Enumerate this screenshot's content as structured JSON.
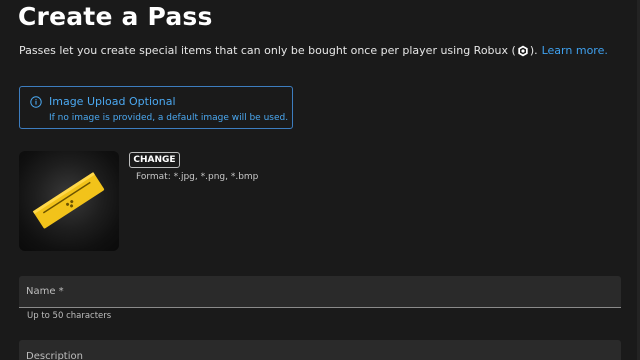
{
  "page": {
    "title": "Create a Pass",
    "subtitle_before": "Passes let you create special items that can only be bought once per player using Robux (",
    "subtitle_after": ").",
    "learn_more": "Learn more."
  },
  "info_box": {
    "title": "Image Upload Optional",
    "text": "If no image is provided, a default image will be used."
  },
  "image_upload": {
    "change_label": "CHANGE",
    "format_text": "Format: *.jpg, *.png, *.bmp"
  },
  "name_field": {
    "label": "Name *",
    "helper": "Up to 50 characters"
  },
  "description_field": {
    "label": "Description"
  },
  "colors": {
    "background": "#1a1a1a",
    "accent_blue": "#3fa1ef",
    "info_border": "#3d7dbf",
    "field_background": "#2a2a2a",
    "pass_gold": "#f2c31a"
  },
  "icons": {
    "robux": "robux-icon",
    "info": "info-icon",
    "thumbnail": "pass-ticket-icon"
  }
}
